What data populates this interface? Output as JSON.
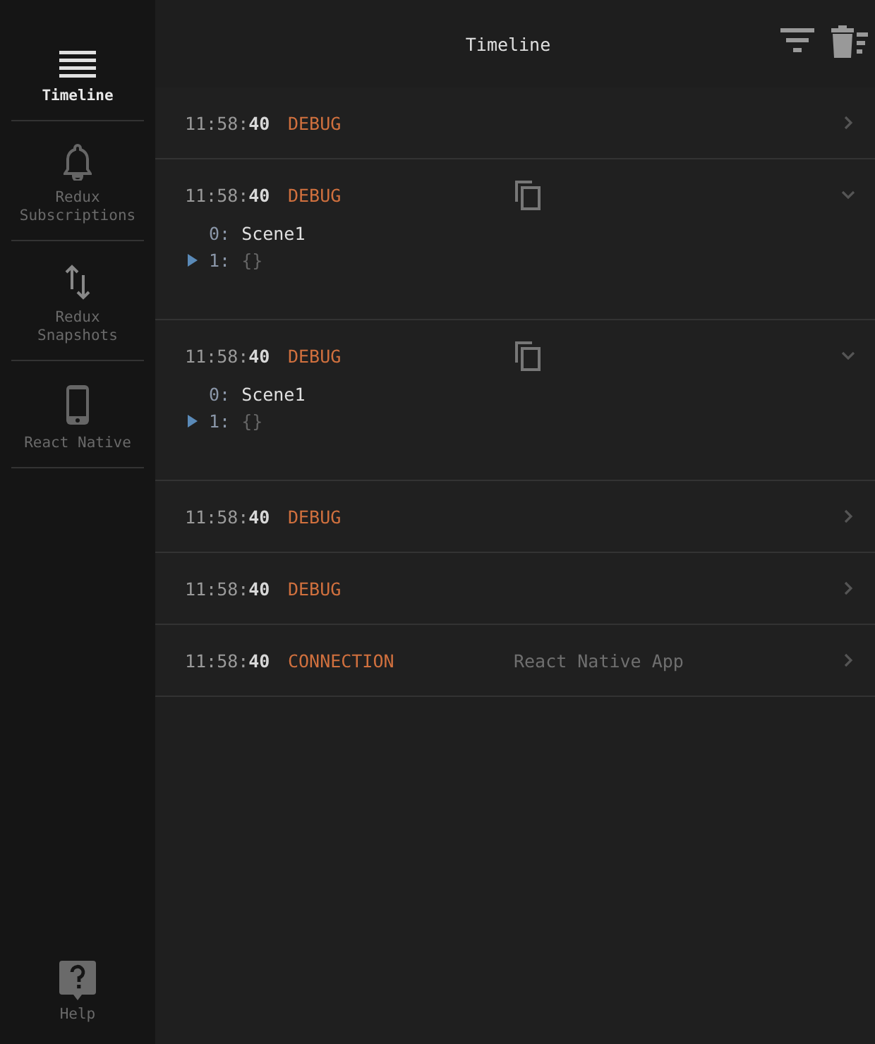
{
  "sidebar": {
    "items": [
      {
        "label": "Timeline",
        "kind": "lines",
        "selected": true
      },
      {
        "label": "Redux Subscriptions",
        "kind": "bell",
        "selected": false
      },
      {
        "label": "Redux Snapshots",
        "kind": "arrows",
        "selected": false
      },
      {
        "label": "React Native",
        "kind": "phone",
        "selected": false
      }
    ],
    "help": {
      "label": "Help"
    }
  },
  "header": {
    "title": "Timeline"
  },
  "events": [
    {
      "time": "11:58:**40**",
      "type": "DEBUG",
      "expanded": false
    },
    {
      "time": "11:58:**40**",
      "type": "DEBUG",
      "expanded": true,
      "payload": [
        {
          "key": "0:",
          "value": "Scene1"
        },
        {
          "key": "1:",
          "value": "{}",
          "expanded": false
        }
      ]
    },
    {
      "time": "11:58:**40**",
      "type": "DEBUG",
      "expanded": true,
      "payload": [
        {
          "key": "0:",
          "value": "Scene1"
        },
        {
          "key": "1:",
          "value": "{}",
          "expanded": false
        }
      ]
    },
    {
      "time": "11:58:**40**",
      "type": "DEBUG",
      "expanded": false
    },
    {
      "time": "11:58:**40**",
      "type": "DEBUG",
      "expanded": false
    },
    {
      "time": "11:58:**40**",
      "type": "CONNECTION",
      "summary": "React Native App",
      "expanded": false
    }
  ]
}
